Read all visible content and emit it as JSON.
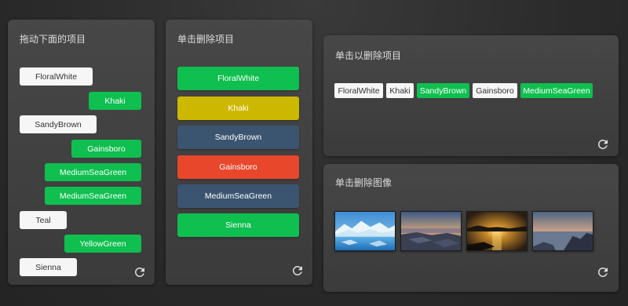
{
  "panel_drag": {
    "title": "拖动下面的项目",
    "items": [
      {
        "label": "FloralWhite",
        "style": "white"
      },
      {
        "label": "Khaki",
        "style": "green"
      },
      {
        "label": "SandyBrown",
        "style": "white"
      },
      {
        "label": "Gainsboro",
        "style": "green"
      },
      {
        "label": "MediumSeaGreen",
        "style": "green"
      },
      {
        "label": "MediumSeaGreen",
        "style": "green"
      },
      {
        "label": "Teal",
        "style": "white"
      },
      {
        "label": "YellowGreen",
        "style": "green"
      },
      {
        "label": "Sienna",
        "style": "white"
      }
    ]
  },
  "panel_delete": {
    "title": "单击删除项目",
    "items": [
      {
        "label": "FloralWhite",
        "color": "#0fbf4f"
      },
      {
        "label": "Khaki",
        "color": "#cdb800"
      },
      {
        "label": "SandyBrown",
        "color": "#3b5570"
      },
      {
        "label": "Gainsboro",
        "color": "#e8472b"
      },
      {
        "label": "MediumSeaGreen",
        "color": "#3b5570"
      },
      {
        "label": "Sienna",
        "color": "#0fbf4f"
      }
    ]
  },
  "panel_tags": {
    "title": "单击以删除项目",
    "tags": [
      {
        "label": "FloralWhite",
        "style": "white"
      },
      {
        "label": "Khaki",
        "style": "white"
      },
      {
        "label": "SandyBrown",
        "style": "green"
      },
      {
        "label": "Gainsboro",
        "style": "white"
      },
      {
        "label": "MediumSeaGreen",
        "style": "green"
      }
    ]
  },
  "panel_images": {
    "title": "单击删除图像",
    "images": [
      {
        "name": "glacier-lake-image"
      },
      {
        "name": "rocky-shore-sunset-image"
      },
      {
        "name": "golden-sunset-sea-image"
      },
      {
        "name": "coastal-rocks-dusk-image"
      }
    ]
  },
  "icons": {
    "reload": "reload-icon"
  },
  "colors": {
    "green": "#0fbf4f",
    "white": "#f6f6f6",
    "panel": "#414141",
    "background": "#2b2b2b"
  }
}
